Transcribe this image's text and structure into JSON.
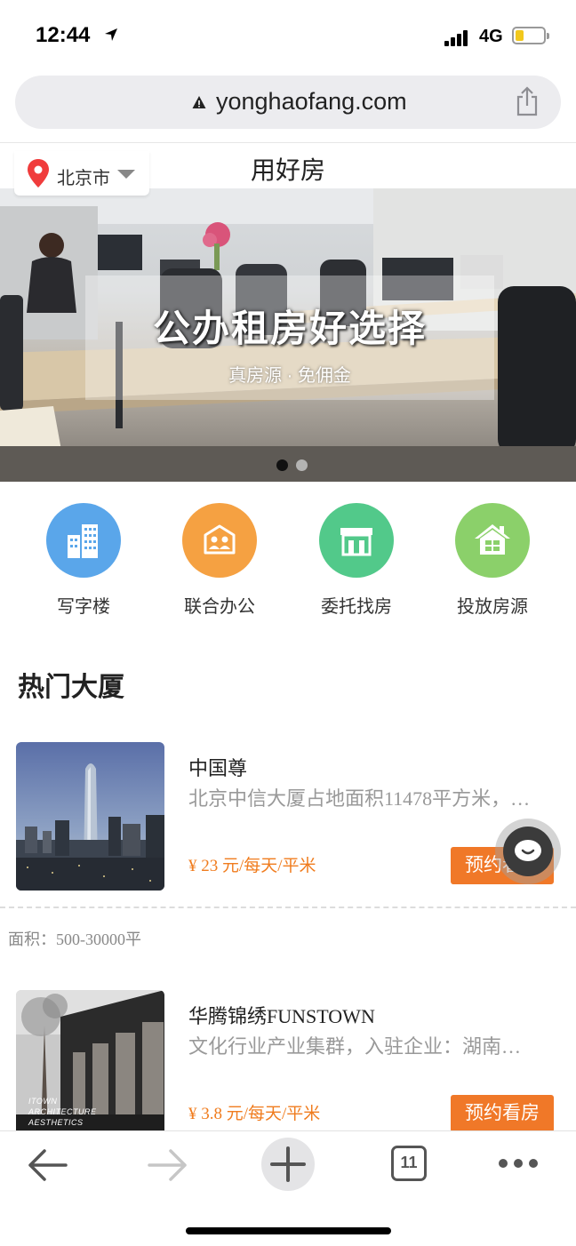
{
  "status_bar": {
    "time": "12:44",
    "network": "4G"
  },
  "browser": {
    "url": "yonghaofang.com",
    "tab_count": "11"
  },
  "header": {
    "city": "北京市",
    "title": "用好房"
  },
  "banner": {
    "headline": "公办租房好选择",
    "subtitle": "真房源 · 免佣金",
    "slide_count": 2,
    "active_slide": 1
  },
  "categories": [
    {
      "label": "写字楼",
      "icon": "office-building-icon",
      "color": "#5aa6ea"
    },
    {
      "label": "联合办公",
      "icon": "coworking-icon",
      "color": "#f5a142"
    },
    {
      "label": "委托找房",
      "icon": "storefront-icon",
      "color": "#52c98a"
    },
    {
      "label": "投放房源",
      "icon": "house-icon",
      "color": "#8bd06a"
    }
  ],
  "section": {
    "title": "热门大厦"
  },
  "listings": [
    {
      "name": "中国尊",
      "description": "北京中信大厦占地面积11478平方米，…",
      "price": "¥ 23 元/每天/平米",
      "button": "预约看房",
      "area": "面积：500-30000平"
    },
    {
      "name": "华腾锦绣FUNSTOWN",
      "description": "文化行业产业集群，入驻企业：湖南…",
      "price": "¥ 3.8 元/每天/平米",
      "button": "预约看房",
      "image_caption": "ITOWN ARCHITECTURE AESTHETICS"
    }
  ],
  "colors": {
    "accent": "#f07828",
    "price": "#f07c1e"
  }
}
